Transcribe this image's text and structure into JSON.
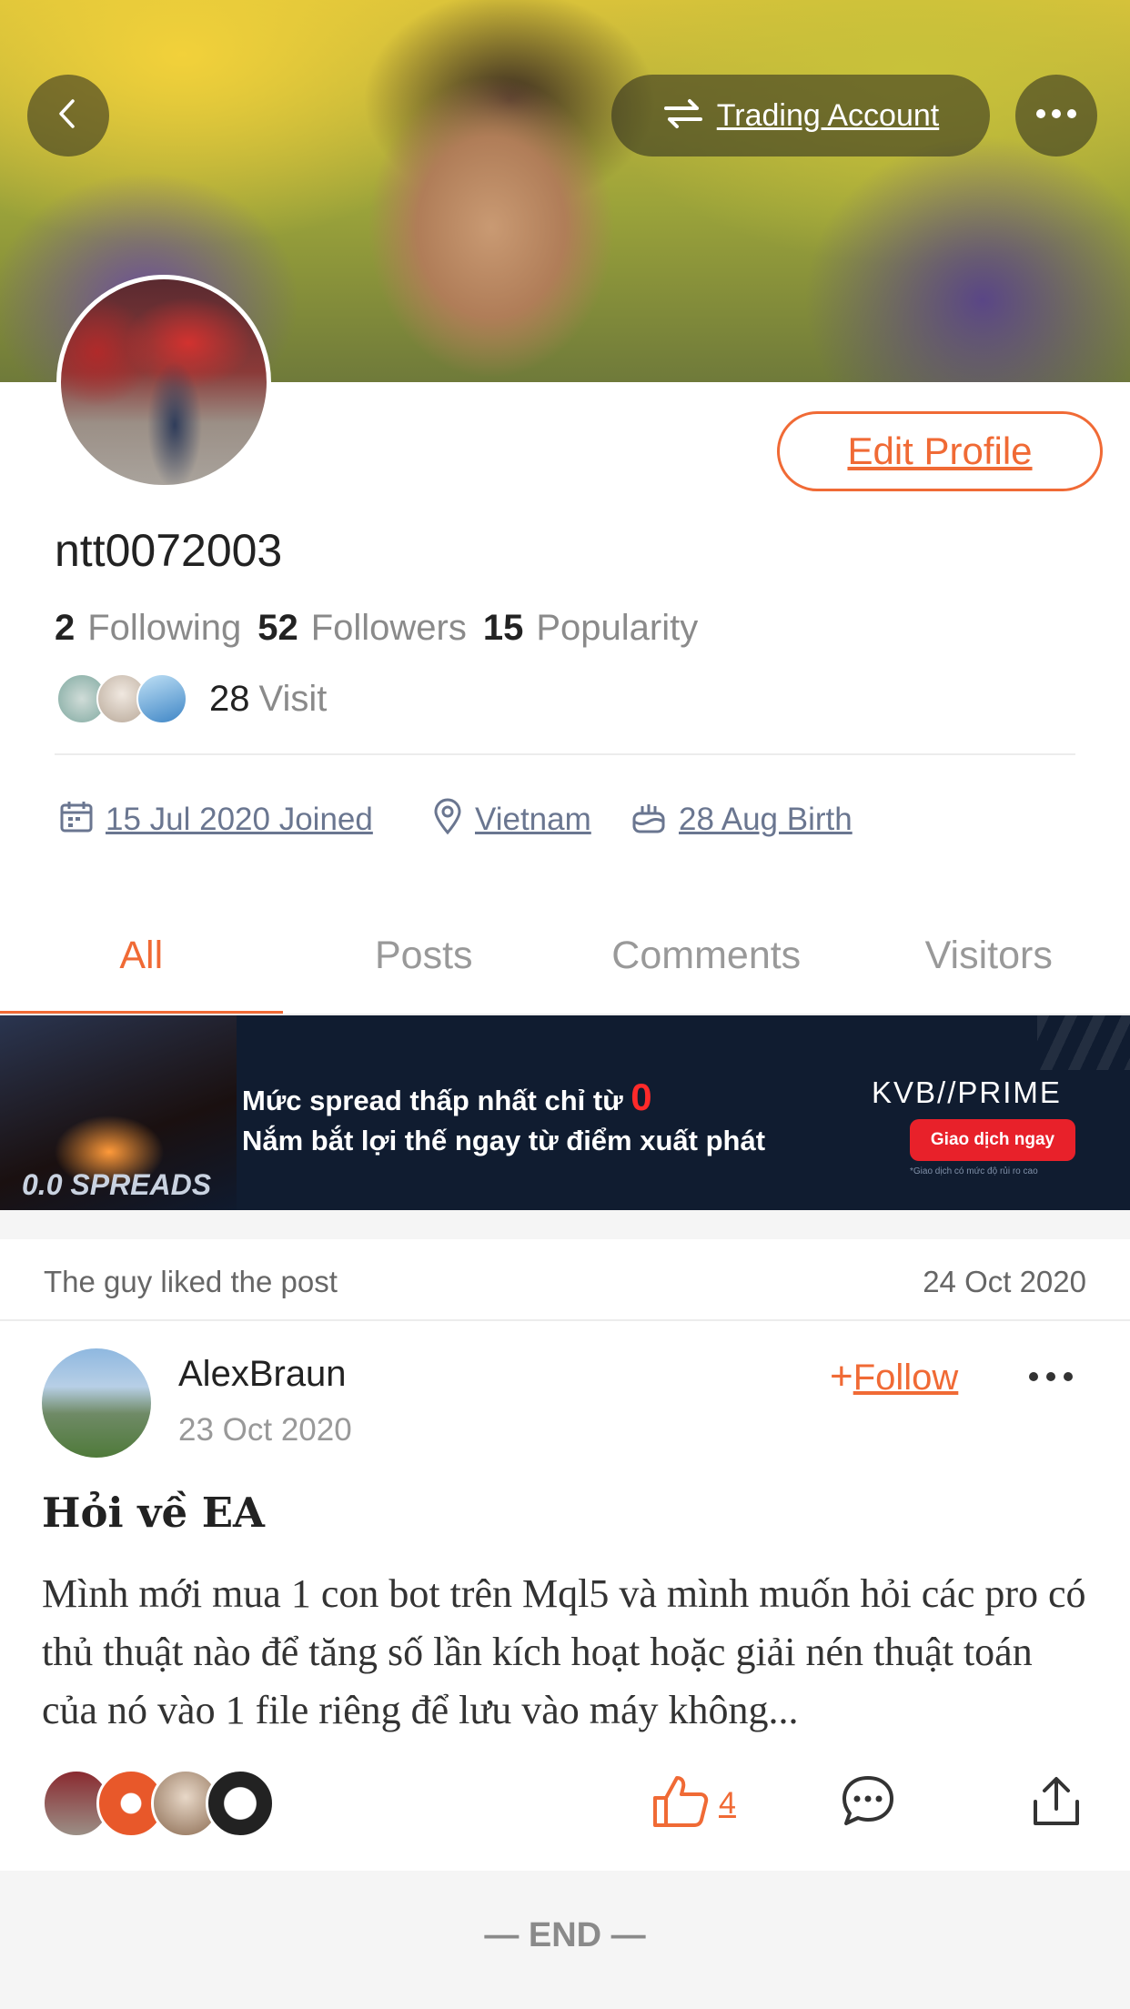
{
  "header": {
    "trading_account_label": "Trading Account"
  },
  "profile": {
    "edit_label": "Edit Profile",
    "username": "ntt0072003",
    "following_count": "2",
    "following_label": "Following",
    "followers_count": "52",
    "followers_label": "Followers",
    "popularity_count": "15",
    "popularity_label": "Popularity",
    "visit_count": "28",
    "visit_label": "Visit",
    "joined": "15 Jul 2020 Joined",
    "location": "Vietnam",
    "birth": "28 Aug Birth"
  },
  "tabs": [
    {
      "label": "All",
      "active": true
    },
    {
      "label": "Posts",
      "active": false
    },
    {
      "label": "Comments",
      "active": false
    },
    {
      "label": "Visitors",
      "active": false
    }
  ],
  "banner": {
    "line1": "Mức spread thấp nhất chỉ từ",
    "line1_highlight": "0",
    "line2": "Nắm bắt lợi thế ngay từ điểm xuất phát",
    "brand": "KVB//PRIME",
    "cta": "Giao dịch ngay",
    "badge": "0.0 SPREADS",
    "fine_print": "*Giao dịch có mức độ rủi ro cao"
  },
  "activity": {
    "text": "The guy liked the post",
    "date": "24 Oct 2020"
  },
  "post": {
    "author": "AlexBraun",
    "date": "23 Oct 2020",
    "follow_plus": "+",
    "follow_label": "Follow",
    "title": "Hỏi về EA",
    "body": "Mình mới mua 1 con bot trên Mql5 và mình muốn hỏi các pro có thủ thuật nào để tăng số lần kích hoạt hoặc giải nén thuật toán của nó vào 1 file riêng để lưu vào máy không...",
    "like_count": "4"
  },
  "footer": {
    "end_label": "— END —"
  },
  "colors": {
    "accent": "#f06a35",
    "meta_link": "#6a7690",
    "banner_bg": "#101c30",
    "banner_cta": "#e8212a"
  },
  "icons": [
    "back-arrow-icon",
    "swap-arrows-icon",
    "more-dots-icon",
    "calendar-icon",
    "location-pin-icon",
    "birthday-cake-icon",
    "thumbs-up-icon",
    "comment-bubble-icon",
    "share-icon"
  ]
}
